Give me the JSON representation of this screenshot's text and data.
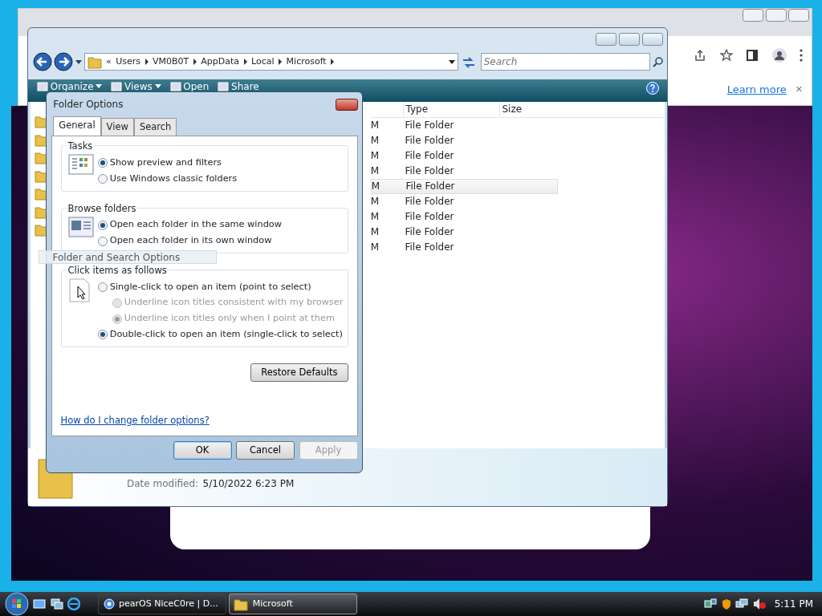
{
  "browser": {
    "infobar_link": "Learn more",
    "infobar_close": "✕"
  },
  "explorer": {
    "breadcrumb_overflow": "«",
    "breadcrumb": [
      "Users",
      "VM0B0T",
      "AppData",
      "Local",
      "Microsoft"
    ],
    "search": {
      "placeholder": "Search"
    },
    "toolbar": [
      {
        "label": "Organize",
        "dropdown": true
      },
      {
        "label": "Views",
        "dropdown": true
      },
      {
        "label": "Open",
        "dropdown": false
      },
      {
        "label": "Share",
        "dropdown": false
      }
    ],
    "columns": [
      "Type",
      "Size"
    ],
    "rows": [
      {
        "column_1": "M",
        "type": "File Folder",
        "hovered": false
      },
      {
        "column_1": "M",
        "type": "File Folder",
        "hovered": false
      },
      {
        "column_1": "M",
        "type": "File Folder",
        "hovered": false
      },
      {
        "column_1": "M",
        "type": "File Folder",
        "hovered": false
      },
      {
        "column_1": "M",
        "type": "File Folder",
        "hovered": true
      },
      {
        "column_1": "M",
        "type": "File Folder",
        "hovered": false
      },
      {
        "column_1": "M",
        "type": "File Folder",
        "hovered": false
      },
      {
        "column_1": "M",
        "type": "File Folder",
        "hovered": false
      },
      {
        "column_1": "M",
        "type": "File Folder",
        "hovered": false
      }
    ],
    "details": {
      "label": "Date modified:",
      "value": "5/10/2022 6:23 PM"
    }
  },
  "dialog": {
    "title": "Folder Options",
    "tabs": [
      {
        "label": "General",
        "selected": true
      },
      {
        "label": "View",
        "selected": false
      },
      {
        "label": "Search",
        "selected": false
      }
    ],
    "groups": [
      {
        "title": "Tasks",
        "options": [
          {
            "label": "Show preview and filters",
            "selected": true,
            "disabled": false
          },
          {
            "label": "Use Windows classic folders",
            "selected": false,
            "disabled": false
          }
        ]
      },
      {
        "title": "Browse folders",
        "options": [
          {
            "label": "Open each folder in the same window",
            "selected": true,
            "disabled": false
          },
          {
            "label": "Open each folder in its own window",
            "selected": false,
            "disabled": false
          }
        ]
      },
      {
        "title": "Click items as follows",
        "options": [
          {
            "label": "Single-click to open an item (point to select)",
            "selected": false,
            "disabled": false,
            "children": [
              {
                "label": "Underline icon titles consistent with my browser",
                "selected": false,
                "disabled": true
              },
              {
                "label": "Underline icon titles only when I point at them",
                "selected": true,
                "disabled": true
              }
            ]
          },
          {
            "label": "Double-click to open an item (single-click to select)",
            "selected": true,
            "disabled": false
          }
        ]
      }
    ],
    "restore_button": "Restore Defaults",
    "help_link": "How do I change folder options?",
    "buttons": [
      {
        "label": "OK",
        "default": true,
        "disabled": false
      },
      {
        "label": "Cancel",
        "default": false,
        "disabled": false
      },
      {
        "label": "Apply",
        "default": false,
        "disabled": true
      }
    ]
  },
  "drag_tooltip": "Folder and Search Options",
  "taskbar": {
    "tasks": [
      {
        "label": "pearOS NiceC0re | D...",
        "kind": "browser",
        "active": false
      },
      {
        "label": "Microsoft",
        "kind": "folder",
        "active": true
      }
    ],
    "clock": "5:11 PM"
  }
}
